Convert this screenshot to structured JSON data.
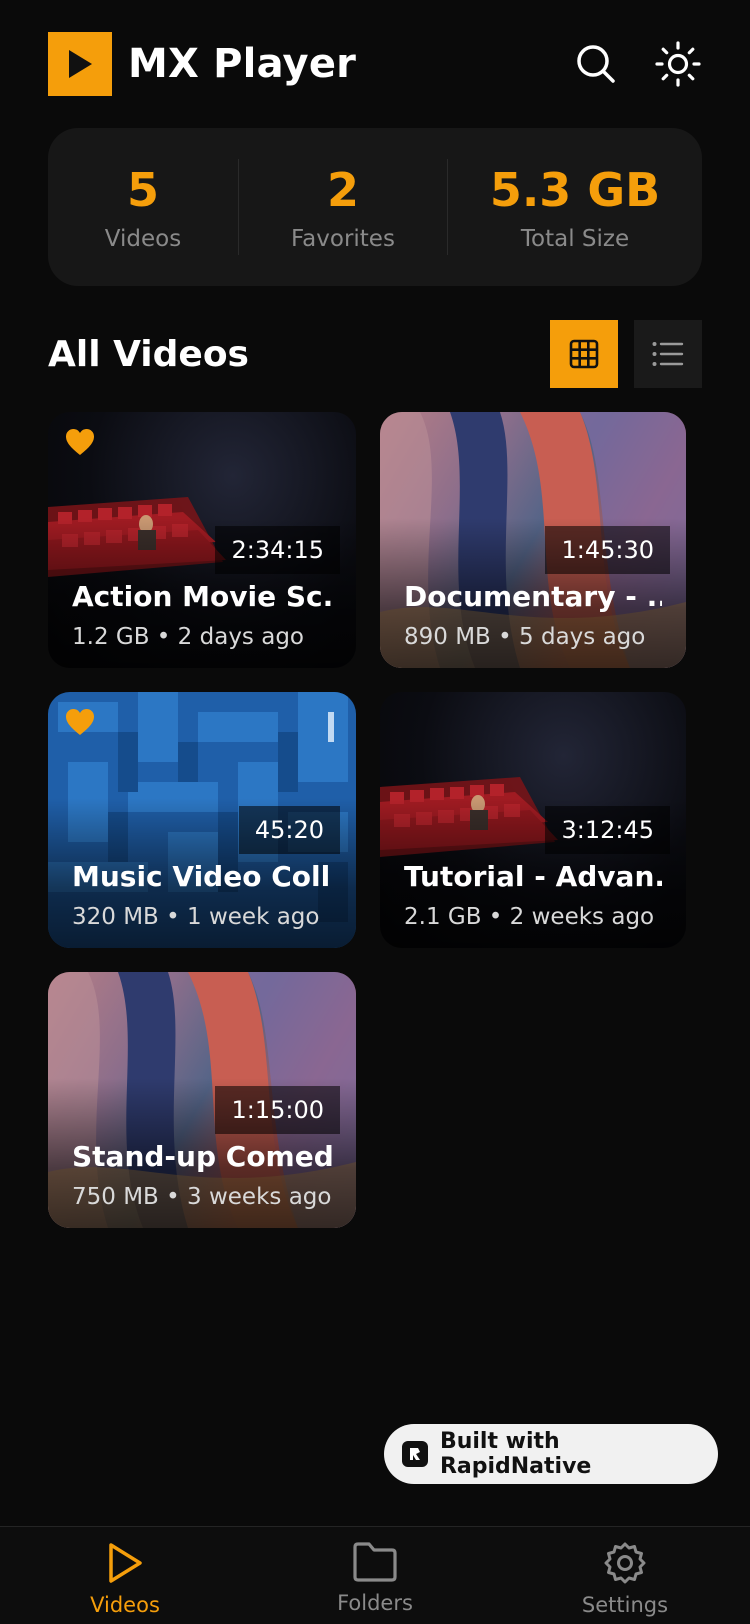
{
  "header": {
    "app_title": "MX Player",
    "logo_icon": "play-icon",
    "search_icon": "search-icon",
    "theme_icon": "sun-icon"
  },
  "stats": [
    {
      "value": "5",
      "label": "Videos"
    },
    {
      "value": "2",
      "label": "Favorites"
    },
    {
      "value": "5.3 GB",
      "label": "Total Size"
    }
  ],
  "section": {
    "title": "All Videos",
    "grid_icon": "grid-view-icon",
    "list_icon": "list-view-icon",
    "active_view": "grid"
  },
  "videos": [
    {
      "title": "Action Movie Sc...",
      "meta": "1.2 GB • 2 days ago",
      "duration": "2:34:15",
      "favorite": true,
      "thumbnail": "cinema"
    },
    {
      "title": "Documentary - ...",
      "meta": "890 MB • 5 days ago",
      "duration": "1:45:30",
      "favorite": false,
      "thumbnail": "abstract"
    },
    {
      "title": "Music Video Coll...",
      "meta": "320 MB • 1 week ago",
      "duration": "45:20",
      "favorite": true,
      "thumbnail": "maze"
    },
    {
      "title": "Tutorial - Advan...",
      "meta": "2.1 GB • 2 weeks ago",
      "duration": "3:12:45",
      "favorite": false,
      "thumbnail": "cinema"
    },
    {
      "title": "Stand-up Comed...",
      "meta": "750 MB • 3 weeks ago",
      "duration": "1:15:00",
      "favorite": false,
      "thumbnail": "abstract"
    }
  ],
  "badge": {
    "text": "Built with RapidNative"
  },
  "bottom_nav": [
    {
      "label": "Videos",
      "icon": "play-outline-icon",
      "active": true
    },
    {
      "label": "Folders",
      "icon": "folder-icon",
      "active": false
    },
    {
      "label": "Settings",
      "icon": "gear-icon",
      "active": false
    }
  ],
  "colors": {
    "accent": "#f59e0b",
    "background": "#0a0a0a",
    "card": "#171717",
    "muted_text": "#8a8a8a"
  }
}
